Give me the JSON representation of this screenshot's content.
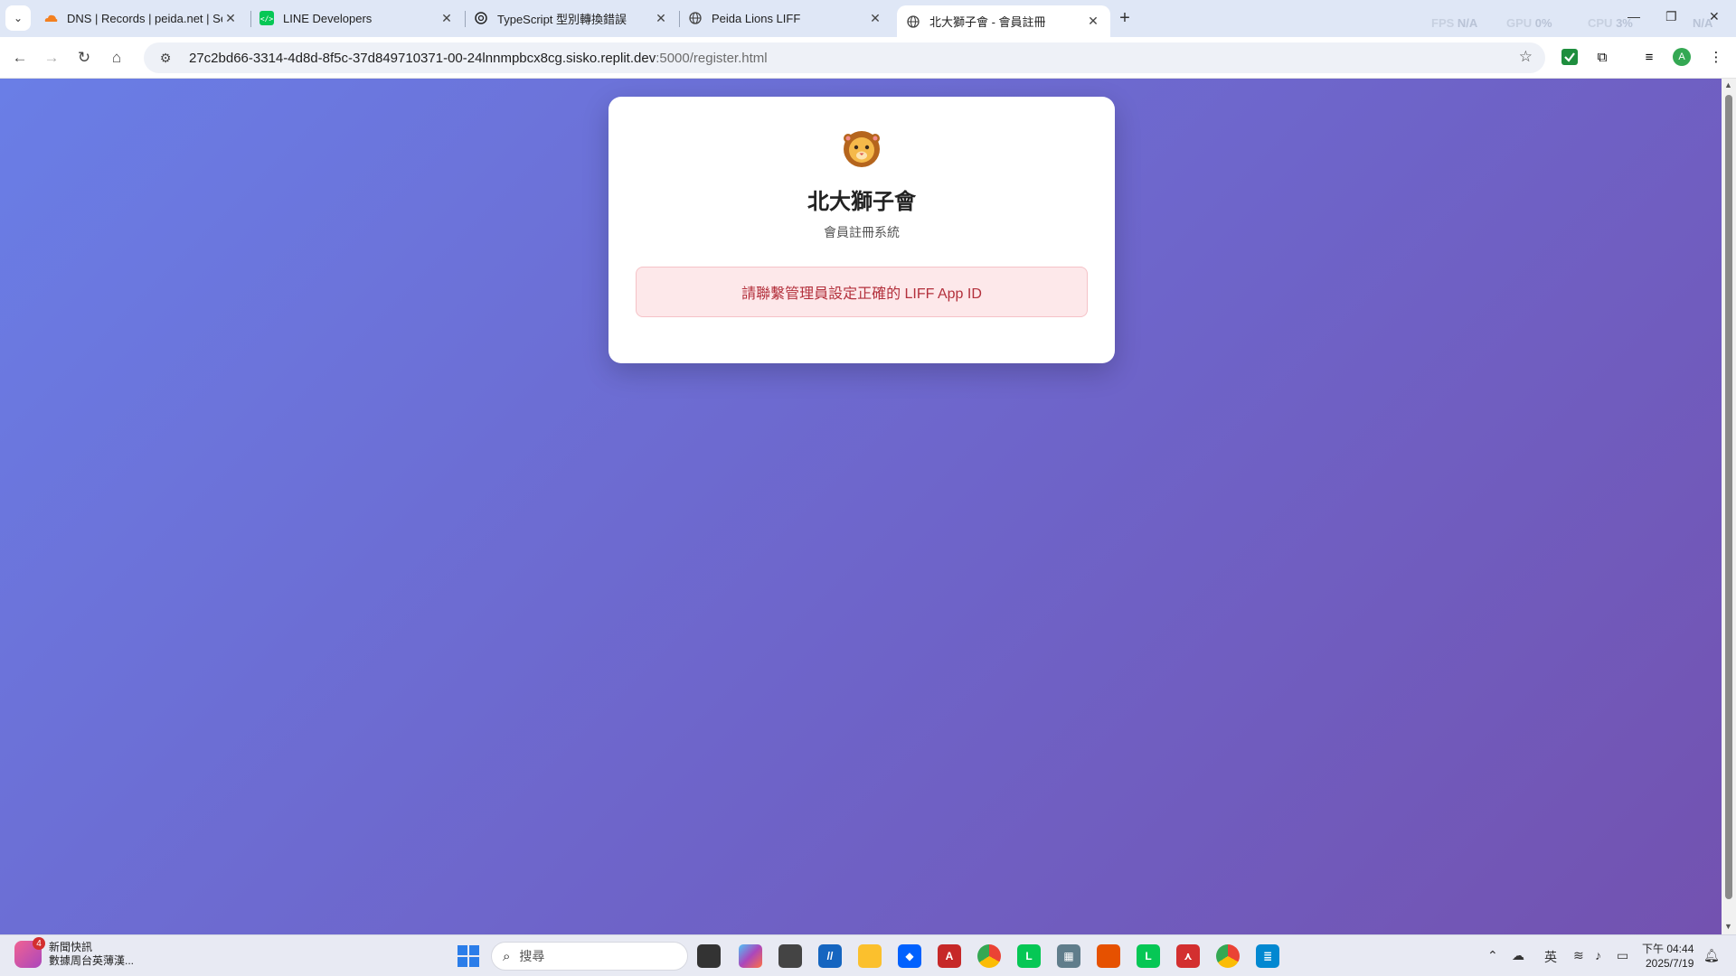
{
  "browser": {
    "tabs": [
      {
        "title": "DNS | Records | peida.net | Se",
        "favicon": "cloudflare-icon",
        "active": false
      },
      {
        "title": "LINE Developers",
        "favicon": "line-dev-icon",
        "active": false
      },
      {
        "title": "TypeScript 型別轉換錯誤",
        "favicon": "openai-icon",
        "active": false
      },
      {
        "title": "Peida Lions LIFF",
        "favicon": "globe-icon",
        "active": false
      },
      {
        "title": "北大獅子會 - 會員註冊",
        "favicon": "globe-icon",
        "active": true
      }
    ],
    "perf": {
      "fps_label": "FPS",
      "fps_value": "N/A",
      "gpu_label": "GPU",
      "gpu_value": "0%",
      "cpu_label": "CPU",
      "cpu_value": "3%",
      "ram_value": "N/A"
    },
    "address": {
      "host": "27c2bd66-3314-4d8d-8f5c-37d849710371-00-24lnnmpbcx8cg.sisko.replit.dev",
      "path": ":5000/register.html"
    },
    "profile_initial": "A"
  },
  "page": {
    "logo": "lion-icon",
    "title": "北大獅子會",
    "subtitle": "會員註冊系統",
    "error": "請聯繫管理員設定正確的 LIFF App ID"
  },
  "taskbar": {
    "news_title": "新聞快訊",
    "news_subtitle": "數據周台英薄漢...",
    "news_badge": "4",
    "search_placeholder": "搜尋",
    "ime": "英",
    "time": "下午 04:44",
    "date": "2025/7/19"
  },
  "colors": {
    "gradient_start": "#6a7ee6",
    "gradient_end": "#7352b0",
    "error_text": "#b3303c",
    "error_bg": "#fde8ea"
  }
}
